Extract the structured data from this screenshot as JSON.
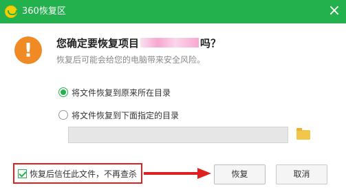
{
  "window": {
    "title": "360恢复区",
    "close_glyph": "×"
  },
  "dialog": {
    "warning_glyph": "!",
    "question_prefix": "您确定要恢复项目",
    "question_suffix": "吗？",
    "subtitle": "恢复后可能会给您的电脑带来安全风险。"
  },
  "options": {
    "original": {
      "label": "将文件恢复到原来所在目录",
      "checked": true
    },
    "custom": {
      "label": "将文件恢复到下面指定的目录",
      "checked": false
    },
    "path_value": ""
  },
  "trust": {
    "label": "恢复后信任此文件，不再查杀",
    "checked": true
  },
  "buttons": {
    "restore": "恢复",
    "cancel": "取消"
  },
  "colors": {
    "brand_green": "#22b14c",
    "warning_orange": "#f08a24",
    "highlight_red": "#e02020"
  }
}
